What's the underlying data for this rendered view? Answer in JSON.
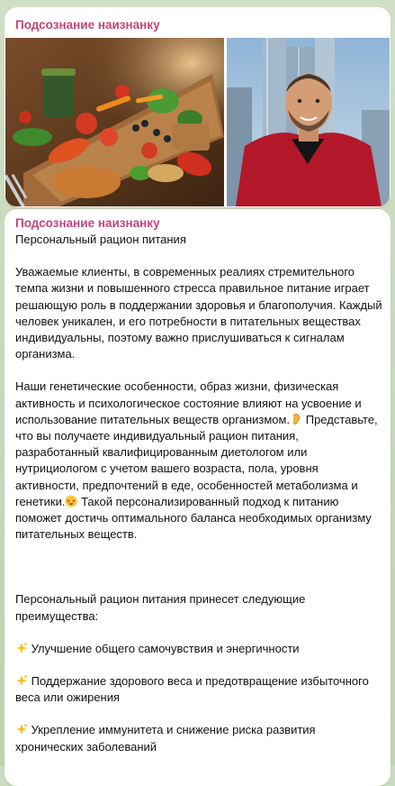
{
  "channel": {
    "sender_name": "Подсознание наизнанку"
  },
  "media": {
    "photo_left": "food-platter-photo",
    "photo_right": "man-portrait-photo"
  },
  "message": {
    "sender_name": "Подсознание наизнанку",
    "title": "Персональный рацион питания",
    "para1": "Уважаемые клиенты, в современных реалиях стремительного темпа жизни и повышенного стресса правильное питание играет решающую роль в поддержании здоровья и благополучия. Каждый человек уникален, и его потребности в питательных веществах индивидуальны, поэтому важно прислушиваться к сигналам организма.",
    "para2a": "Наши генетические особенности, образ жизни, физическая активность и психологическое состояние влияют на усвоение и использование питательных веществ организмом.",
    "para2b": "Представьте, что вы получаете индивидуальный рацион питания, разработанный квалифицированным диетологом или нутрициологом с учетом вашего возраста, пола, уровня активности, предпочтений в еде, особенностей метаболизма и генетики.",
    "para2c": "Такой персонализированный подход к питанию поможет достичь оптимального баланса необходимых организму питательных веществ.",
    "benefits_intro": "Персональный рацион питания принесет следующие преимущества:",
    "benefits": [
      "Улучшение общего самочувствия и энергичности",
      "Поддержание здорового веса и предотвращение избыточного веса или ожирения",
      "Укрепление иммунитета и снижение риска развития хронических заболеваний"
    ],
    "emoji": {
      "ear": "ear-emoji",
      "star_face": "star-struck-emoji",
      "sparkles": "sparkles-emoji"
    }
  },
  "colors": {
    "sender": "#c0457d",
    "bubble": "#ffffff",
    "chat_bg": "#c9dcc0"
  }
}
